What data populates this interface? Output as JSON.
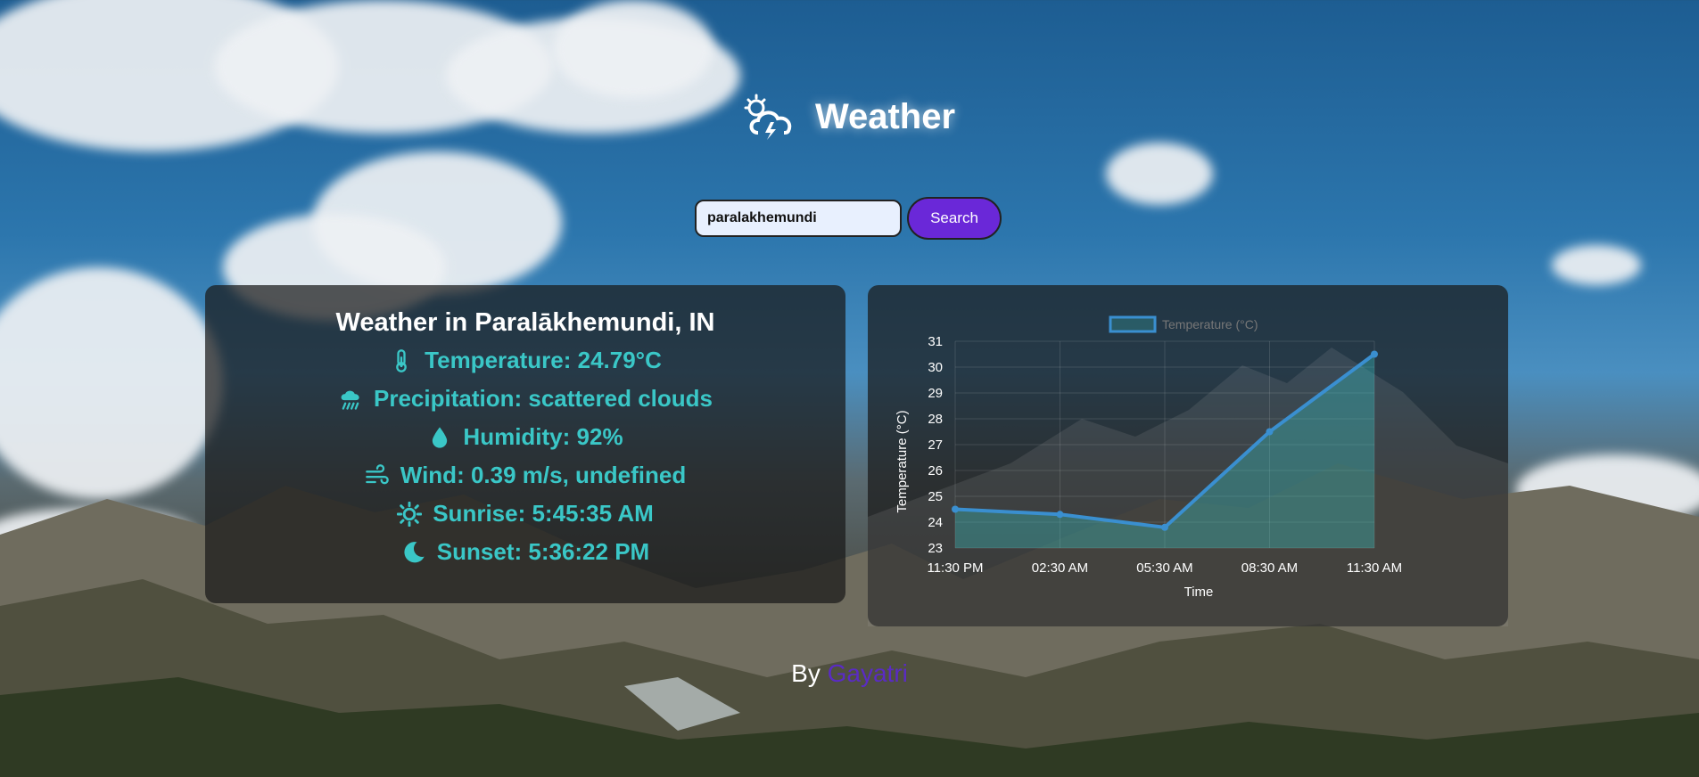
{
  "header": {
    "title": "Weather",
    "logo_icon": "storm-cloud-icon"
  },
  "search": {
    "value": "paralakhemundi",
    "button_label": "Search"
  },
  "weather": {
    "heading": "Weather in Paralākhemundi, IN",
    "temperature": "Temperature: 24.79°C",
    "precipitation": "Precipitation: scattered clouds",
    "humidity": "Humidity: 92%",
    "wind": "Wind: 0.39 m/s, undefined",
    "sunrise": "Sunrise: 5:45:35 AM",
    "sunset": "Sunset: 5:36:22 PM"
  },
  "footer": {
    "prefix": "By",
    "author": "Gayatri"
  },
  "colors": {
    "accent": "#3ac7c7",
    "button": "#6a28d8",
    "line": "#3a8fd0"
  },
  "chart_data": {
    "type": "line",
    "categories": [
      "11:30 PM",
      "02:30 AM",
      "05:30 AM",
      "08:30 AM",
      "11:30 AM"
    ],
    "series": [
      {
        "name": "Temperature (°C)",
        "values": [
          24.5,
          24.3,
          23.8,
          27.5,
          30.5
        ]
      }
    ],
    "xlabel": "Time",
    "ylabel": "Temperature (°C)",
    "ylim": [
      23,
      31
    ],
    "yticks": [
      23,
      24,
      25,
      26,
      27,
      28,
      29,
      30,
      31
    ],
    "fill": true,
    "legend": "top"
  }
}
